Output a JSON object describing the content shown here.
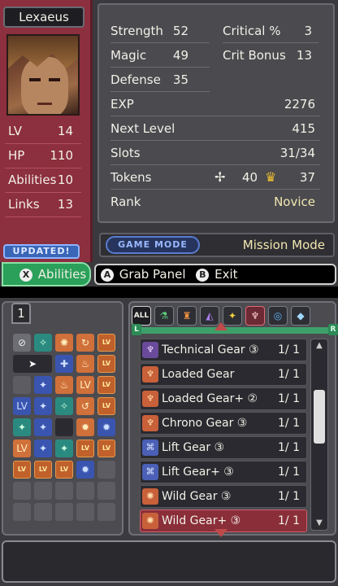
{
  "character": {
    "name": "Lexaeus",
    "left_stats": [
      {
        "label": "LV",
        "value": "14"
      },
      {
        "label": "HP",
        "value": "110"
      },
      {
        "label": "Abilities",
        "value": "10"
      },
      {
        "label": "Links",
        "value": "13"
      }
    ]
  },
  "stats": {
    "strength": {
      "label": "Strength",
      "value": "52"
    },
    "critical": {
      "label": "Critical %",
      "value": "3"
    },
    "magic": {
      "label": "Magic",
      "value": "49"
    },
    "crit_bonus": {
      "label": "Crit Bonus",
      "value": "13"
    },
    "defense": {
      "label": "Defense",
      "value": "35"
    },
    "exp": {
      "label": "EXP",
      "value": "2276"
    },
    "next_level": {
      "label": "Next Level",
      "value": "415"
    },
    "slots": {
      "label": "Slots",
      "value": "31/34"
    },
    "tokens": {
      "label": "Tokens",
      "value1": "40",
      "value2": "37"
    },
    "rank": {
      "label": "Rank",
      "value": "Novice"
    }
  },
  "badges": {
    "updated": "UPDATED!"
  },
  "tabs": {
    "abilities": "Abilities",
    "abilities_button": "X"
  },
  "mode": {
    "label": "GAME MODE",
    "value": "Mission Mode"
  },
  "hints": {
    "a_button": "A",
    "a_label": "Grab Panel",
    "b_button": "B",
    "b_label": "Exit"
  },
  "grid": {
    "page": "1"
  },
  "categories": {
    "all": "ALL"
  },
  "rail": {
    "left": "L",
    "right": "R"
  },
  "items": [
    {
      "name": "Technical Gear ③",
      "count": "1/ 1"
    },
    {
      "name": "Loaded Gear",
      "count": "1/ 1"
    },
    {
      "name": "Loaded Gear+ ②",
      "count": "1/ 1"
    },
    {
      "name": "Chrono Gear ③",
      "count": "1/ 1"
    },
    {
      "name": "Lift Gear ③",
      "count": "1/ 1"
    },
    {
      "name": "Lift Gear+ ③",
      "count": "1/ 1"
    },
    {
      "name": "Wild Gear ③",
      "count": "1/ 1"
    },
    {
      "name": "Wild Gear+ ③",
      "count": "1/ 1"
    }
  ],
  "colors": {
    "char_panel": "#8c2f3e",
    "abilities_tab": "#2aa05a",
    "selected_item": "#8a2f3a",
    "updated_badge": "#3a66b8"
  }
}
